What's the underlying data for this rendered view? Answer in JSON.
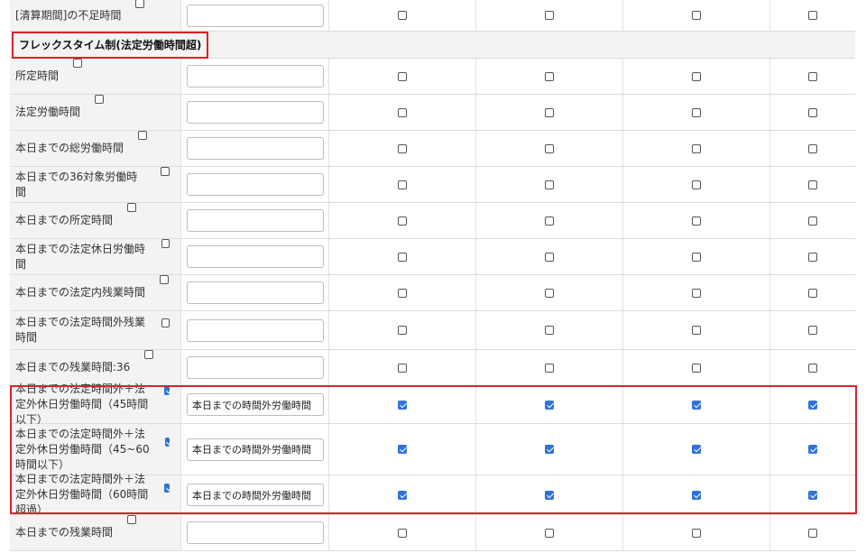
{
  "rows_top": [
    {
      "label": "[清算期間]の不足時間",
      "label_checked": false,
      "value": "",
      "checks": [
        false,
        false,
        false,
        false
      ],
      "h": 35
    }
  ],
  "section": {
    "title": "フレックスタイム制(法定労働時間超)"
  },
  "rows": [
    {
      "label": "所定時間",
      "label_checked": false,
      "value": "",
      "checks": [
        false,
        false,
        false,
        false
      ],
      "h": 40
    },
    {
      "label": "法定労働時間",
      "label_checked": false,
      "value": "",
      "checks": [
        false,
        false,
        false,
        false
      ],
      "h": 40
    },
    {
      "label": "本日までの総労働時間",
      "label_checked": false,
      "value": "",
      "checks": [
        false,
        false,
        false,
        false
      ],
      "h": 40
    },
    {
      "label": "本日までの36対象労働時間",
      "label_checked": false,
      "value": "",
      "checks": [
        false,
        false,
        false,
        false
      ],
      "h": 40
    },
    {
      "label": "本日までの所定時間",
      "label_checked": false,
      "value": "",
      "checks": [
        false,
        false,
        false,
        false
      ],
      "h": 40
    },
    {
      "label": "本日までの法定休日労働時間",
      "label_checked": false,
      "value": "",
      "checks": [
        false,
        false,
        false,
        false
      ],
      "h": 40
    },
    {
      "label": "本日までの法定内残業時間",
      "label_checked": false,
      "value": "",
      "checks": [
        false,
        false,
        false,
        false
      ],
      "h": 40
    },
    {
      "label": "本日までの法定時間外残業時間",
      "label_checked": false,
      "value": "",
      "checks": [
        false,
        false,
        false,
        false
      ],
      "h": 43
    },
    {
      "label": "本日までの残業時間:36",
      "label_checked": false,
      "value": "",
      "checks": [
        false,
        false,
        false,
        false
      ],
      "h": 40
    },
    {
      "label": "本日までの法定時間外＋法定外休日労働時間（45時間以下）",
      "label_checked": true,
      "value": "本日までの時間外労働時間",
      "checks": [
        true,
        true,
        true,
        true
      ],
      "h": 42
    },
    {
      "label": "本日までの法定時間外＋法定外休日労働時間（45~60時間以下）",
      "label_checked": true,
      "value": "本日までの時間外労働時間",
      "checks": [
        true,
        true,
        true,
        true
      ],
      "h": 57
    },
    {
      "label": "本日までの法定時間外＋法定外休日労働時間（60時間超過）",
      "label_checked": true,
      "value": "本日までの時間外労働時間",
      "checks": [
        true,
        true,
        true,
        true
      ],
      "h": 44
    },
    {
      "label": "本日までの残業時間",
      "label_checked": false,
      "value": "",
      "checks": [
        false,
        false,
        false,
        false
      ],
      "h": 40
    }
  ]
}
